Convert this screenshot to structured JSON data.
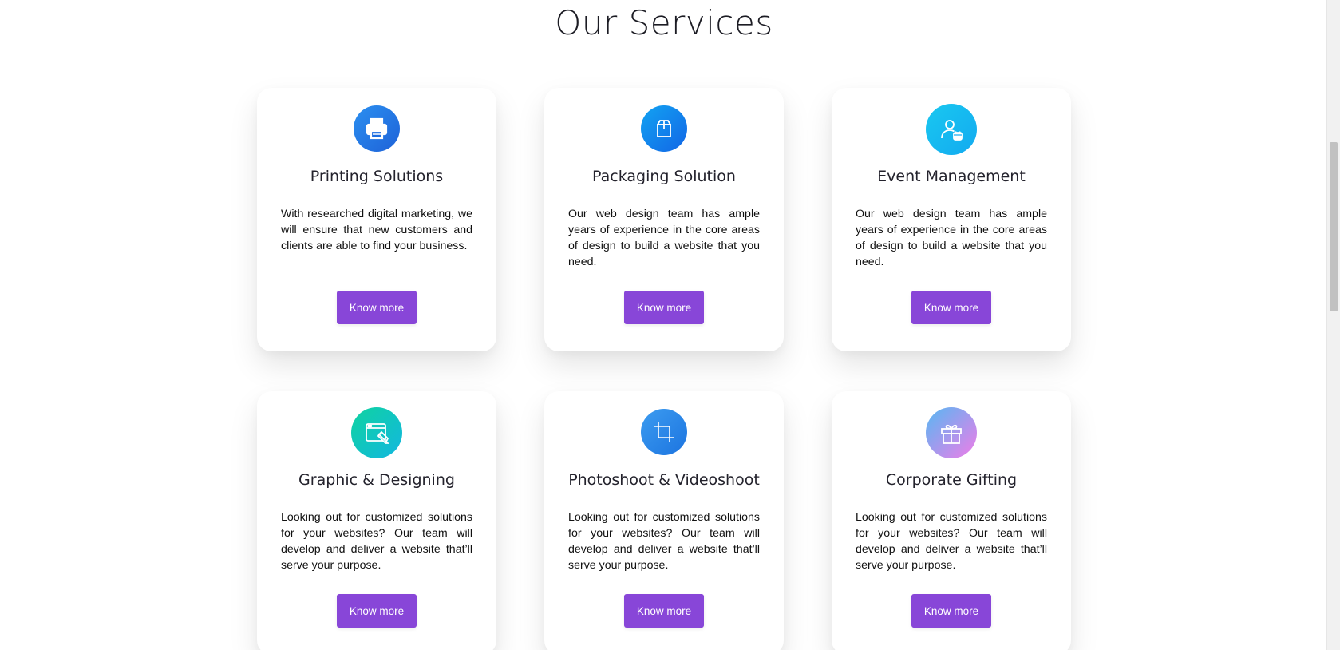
{
  "section": {
    "title": "Our Services"
  },
  "cards": [
    {
      "title": "Printing Solutions",
      "description": "With researched digital marketing, we will ensure that new customers and clients are able to find your business.",
      "button_label": "Know more",
      "icon": "printer-icon",
      "gradient": [
        "#2b8ff0",
        "#1e62d8"
      ]
    },
    {
      "title": "Packaging Solution",
      "description": "Our web design team has ample years of experience in the core areas of design to build a website that you need.",
      "button_label": "Know more",
      "icon": "box-icon",
      "gradient": [
        "#12a3f2",
        "#1266e6"
      ]
    },
    {
      "title": "Event Management",
      "description": "Our web design team has ample years of experience in the core areas of design to build a website that you need.",
      "button_label": "Know more",
      "icon": "user-calendar-icon",
      "gradient": [
        "#19c8f0",
        "#13aaf0"
      ]
    },
    {
      "title": "Graphic & Designing",
      "description": "Looking out for customized solutions for your websites? Our team will develop and deliver a website that’ll serve your purpose.",
      "button_label": "Know more",
      "icon": "browser-pen-icon",
      "gradient": [
        "#10d3a0",
        "#12b7e0"
      ]
    },
    {
      "title": "Photoshoot & Videoshoot",
      "description": "Looking out for customized solutions for your websites? Our team will develop and deliver a website that’ll serve your purpose.",
      "button_label": "Know more",
      "icon": "crop-icon",
      "gradient": [
        "#3c9cf0",
        "#1c74e0"
      ]
    },
    {
      "title": "Corporate Gifting",
      "description": "Looking out for customized solutions for your websites? Our team will develop and deliver a website that’ll serve your purpose.",
      "button_label": "Know more",
      "icon": "gift-icon",
      "gradient": [
        "#56b8f2",
        "#f07ce8"
      ]
    }
  ],
  "colors": {
    "button": "#8846d8",
    "title_text": "#1c1c24"
  }
}
